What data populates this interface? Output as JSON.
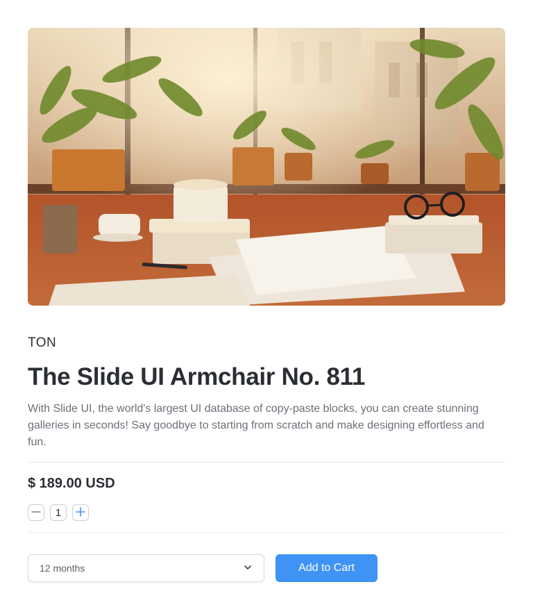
{
  "product": {
    "image_alt": "Sunlit desk with papers, potted plants, coffee cup and glasses",
    "brand": "TON",
    "title": "The Slide UI Armchair No. 811",
    "description": "With Slide UI, the world's largest UI database of copy-paste blocks, you can create stunning galleries in seconds! Say goodbye to starting from scratch and make designing effortless and fun.",
    "price": "$ 189.00 USD"
  },
  "quantity": {
    "value": "1",
    "decrement_icon": "minus-icon",
    "increment_icon": "plus-icon"
  },
  "plan_select": {
    "selected": "12 months",
    "icon": "chevron-down-icon"
  },
  "cart": {
    "add_label": "Add to Cart"
  },
  "colors": {
    "accent": "#3f93f5",
    "text": "#2b2e33",
    "muted": "#6a6f78",
    "border": "#c9ccd1"
  }
}
